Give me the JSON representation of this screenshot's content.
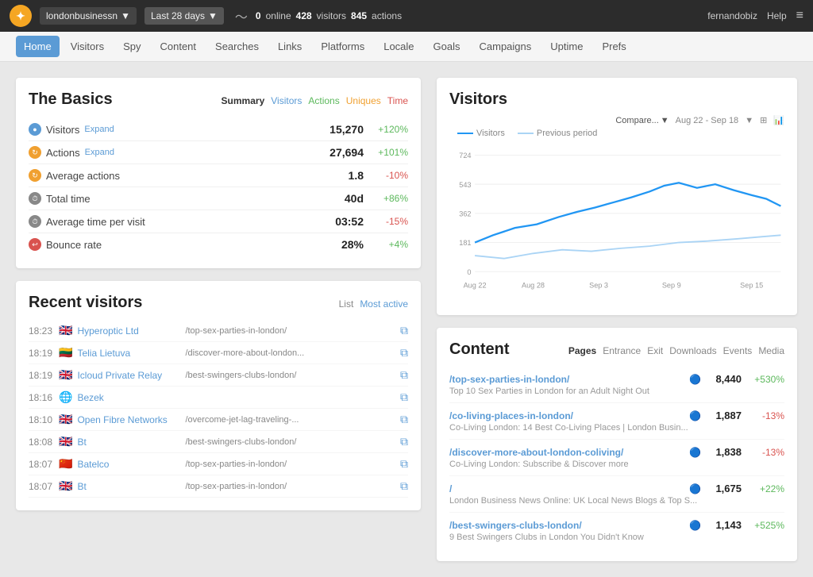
{
  "topnav": {
    "logo": "C",
    "site": "londonbusinessn",
    "dateRange": "Last 28 days",
    "online": "0",
    "visitors": "428",
    "actions": "845",
    "online_label": "online",
    "visitors_label": "visitors",
    "actions_label": "actions",
    "username": "fernandobiz",
    "help": "Help"
  },
  "subnav": {
    "items": [
      {
        "label": "Home",
        "active": true
      },
      {
        "label": "Visitors",
        "active": false
      },
      {
        "label": "Spy",
        "active": false
      },
      {
        "label": "Content",
        "active": false
      },
      {
        "label": "Searches",
        "active": false
      },
      {
        "label": "Links",
        "active": false
      },
      {
        "label": "Platforms",
        "active": false
      },
      {
        "label": "Locale",
        "active": false
      },
      {
        "label": "Goals",
        "active": false
      },
      {
        "label": "Campaigns",
        "active": false
      },
      {
        "label": "Uptime",
        "active": false
      },
      {
        "label": "Prefs",
        "active": false
      }
    ]
  },
  "basics": {
    "title": "The Basics",
    "tabs": [
      {
        "label": "Summary",
        "active": true
      },
      {
        "label": "Visitors",
        "color": "blue"
      },
      {
        "label": "Actions",
        "color": "green"
      },
      {
        "label": "Uniques",
        "color": "orange"
      },
      {
        "label": "Time",
        "color": "red"
      }
    ],
    "rows": [
      {
        "icon": "visitors",
        "label": "Visitors",
        "expand": true,
        "value": "15,270",
        "change": "+120%",
        "positive": true
      },
      {
        "icon": "actions",
        "label": "Actions",
        "expand": true,
        "value": "27,694",
        "change": "+101%",
        "positive": true
      },
      {
        "icon": "avgactions",
        "label": "Average actions",
        "expand": false,
        "value": "1.8",
        "change": "-10%",
        "positive": false
      },
      {
        "icon": "time",
        "label": "Total time",
        "expand": false,
        "value": "40d",
        "change": "+86%",
        "positive": true
      },
      {
        "icon": "time",
        "label": "Average time per visit",
        "expand": false,
        "value": "03:52",
        "change": "-15%",
        "positive": false
      },
      {
        "icon": "bounce",
        "label": "Bounce rate",
        "expand": false,
        "value": "28%",
        "change": "+4%",
        "positive": false
      }
    ]
  },
  "recentVisitors": {
    "title": "Recent visitors",
    "tabs": [
      {
        "label": "List",
        "active": true
      },
      {
        "label": "Most active",
        "color": "blue"
      }
    ],
    "rows": [
      {
        "time": "18:23",
        "flag": "🇬🇧",
        "name": "Hyperoptic Ltd",
        "url": "/top-sex-parties-in-london/"
      },
      {
        "time": "18:19",
        "flag": "🇱🇹",
        "name": "Telia Lietuva",
        "url": "/discover-more-about-london..."
      },
      {
        "time": "18:19",
        "flag": "🇬🇧",
        "name": "Icloud Private Relay",
        "url": "/best-swingers-clubs-london/"
      },
      {
        "time": "18:16",
        "flag": "🌐",
        "name": "Bezek",
        "url": ""
      },
      {
        "time": "18:10",
        "flag": "🇬🇧",
        "name": "Open Fibre Networks",
        "url": "/overcome-jet-lag-traveling-..."
      },
      {
        "time": "18:08",
        "flag": "🇬🇧",
        "name": "Bt",
        "url": "/best-swingers-clubs-london/"
      },
      {
        "time": "18:07",
        "flag": "🇨🇳",
        "name": "Batelco",
        "url": "/top-sex-parties-in-london/"
      },
      {
        "time": "18:07",
        "flag": "🇬🇧",
        "name": "Bt",
        "url": "/top-sex-parties-in-london/"
      }
    ]
  },
  "visitorsChart": {
    "title": "Visitors",
    "compare": "Compare...",
    "dateRange": "Aug 22 - Sep 18",
    "legend": {
      "visitors": "Visitors",
      "previous": "Previous period"
    },
    "yLabels": [
      "724",
      "543",
      "362",
      "181",
      "0"
    ],
    "xLabels": [
      "Aug 22",
      "Aug 28",
      "Sep 3",
      "Sep 9",
      "Sep 15"
    ]
  },
  "content": {
    "title": "Content",
    "tabs": [
      {
        "label": "Pages",
        "active": true
      },
      {
        "label": "Entrance"
      },
      {
        "label": "Exit"
      },
      {
        "label": "Downloads"
      },
      {
        "label": "Events"
      },
      {
        "label": "Media"
      }
    ],
    "rows": [
      {
        "url": "/top-sex-parties-in-london/",
        "count": "8,440",
        "change": "+530%",
        "positive": true,
        "desc": "Top 10 Sex Parties in London for an Adult Night Out"
      },
      {
        "url": "/co-living-places-in-london/",
        "count": "1,887",
        "change": "-13%",
        "positive": false,
        "desc": "Co-Living London: 14 Best Co-Living Places | London Busin..."
      },
      {
        "url": "/discover-more-about-london-coliving/",
        "count": "1,838",
        "change": "-13%",
        "positive": false,
        "desc": "Co-Living London: Subscribe & Discover more"
      },
      {
        "url": "/",
        "count": "1,675",
        "change": "+22%",
        "positive": true,
        "desc": "London Business News Online: UK Local News Blogs & Top S..."
      },
      {
        "url": "/best-swingers-clubs-london/",
        "count": "1,143",
        "change": "+525%",
        "positive": true,
        "desc": "9 Best Swingers Clubs in London You Didn't Know"
      }
    ]
  }
}
